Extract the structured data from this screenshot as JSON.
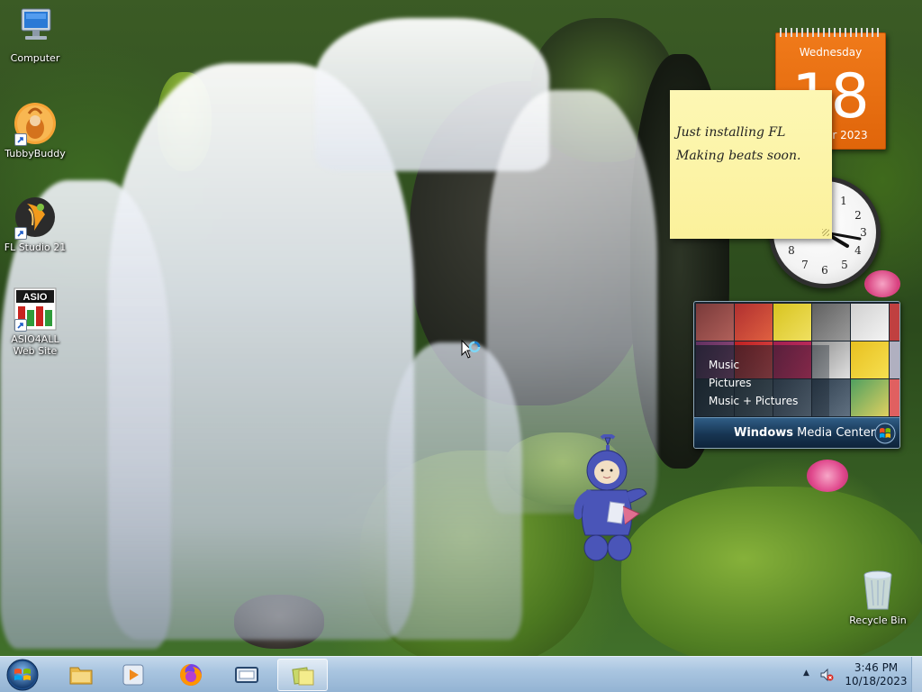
{
  "desktop": {
    "icons": [
      {
        "label": "Computer",
        "icon": "computer-icon"
      },
      {
        "label": "TubbyBuddy",
        "icon": "tubbybuddy-icon"
      },
      {
        "label": "FL Studio 21",
        "icon": "fl-studio-icon"
      },
      {
        "label": "ASIO4ALL\nWeb Site",
        "line1": "ASIO4ALL",
        "line2": "Web Site",
        "icon": "asio4all-icon"
      },
      {
        "label": "Recycle Bin",
        "icon": "recycle-bin-icon"
      }
    ]
  },
  "calendar": {
    "weekday": "Wednesday",
    "date": "18",
    "month_year": "October 2023",
    "accent": "#e8700f"
  },
  "sticky_note": {
    "line1": "Just installing FL",
    "line2": "Making beats soon."
  },
  "media_center": {
    "menu": [
      "Music",
      "Pictures",
      "Music + Pictures"
    ],
    "title_bold": "Windows",
    "title_rest": " Media Center"
  },
  "taskbar": {
    "buttons": [
      {
        "name": "windows-explorer",
        "icon": "folder-icon"
      },
      {
        "name": "media-player",
        "icon": "media-player-icon"
      },
      {
        "name": "firefox",
        "icon": "firefox-icon"
      },
      {
        "name": "app-window",
        "icon": "window-icon"
      },
      {
        "name": "sticky-notes",
        "icon": "sticky-notes-icon",
        "active": true
      }
    ],
    "tray": {
      "time": "3:46 PM",
      "date": "10/18/2023",
      "arrow": "▲"
    }
  },
  "colors": {
    "taskbar": "#a9c5e0",
    "sticky": "#fbf19b",
    "calendar": "#e8700f",
    "teletubby": "#4a55b8"
  }
}
